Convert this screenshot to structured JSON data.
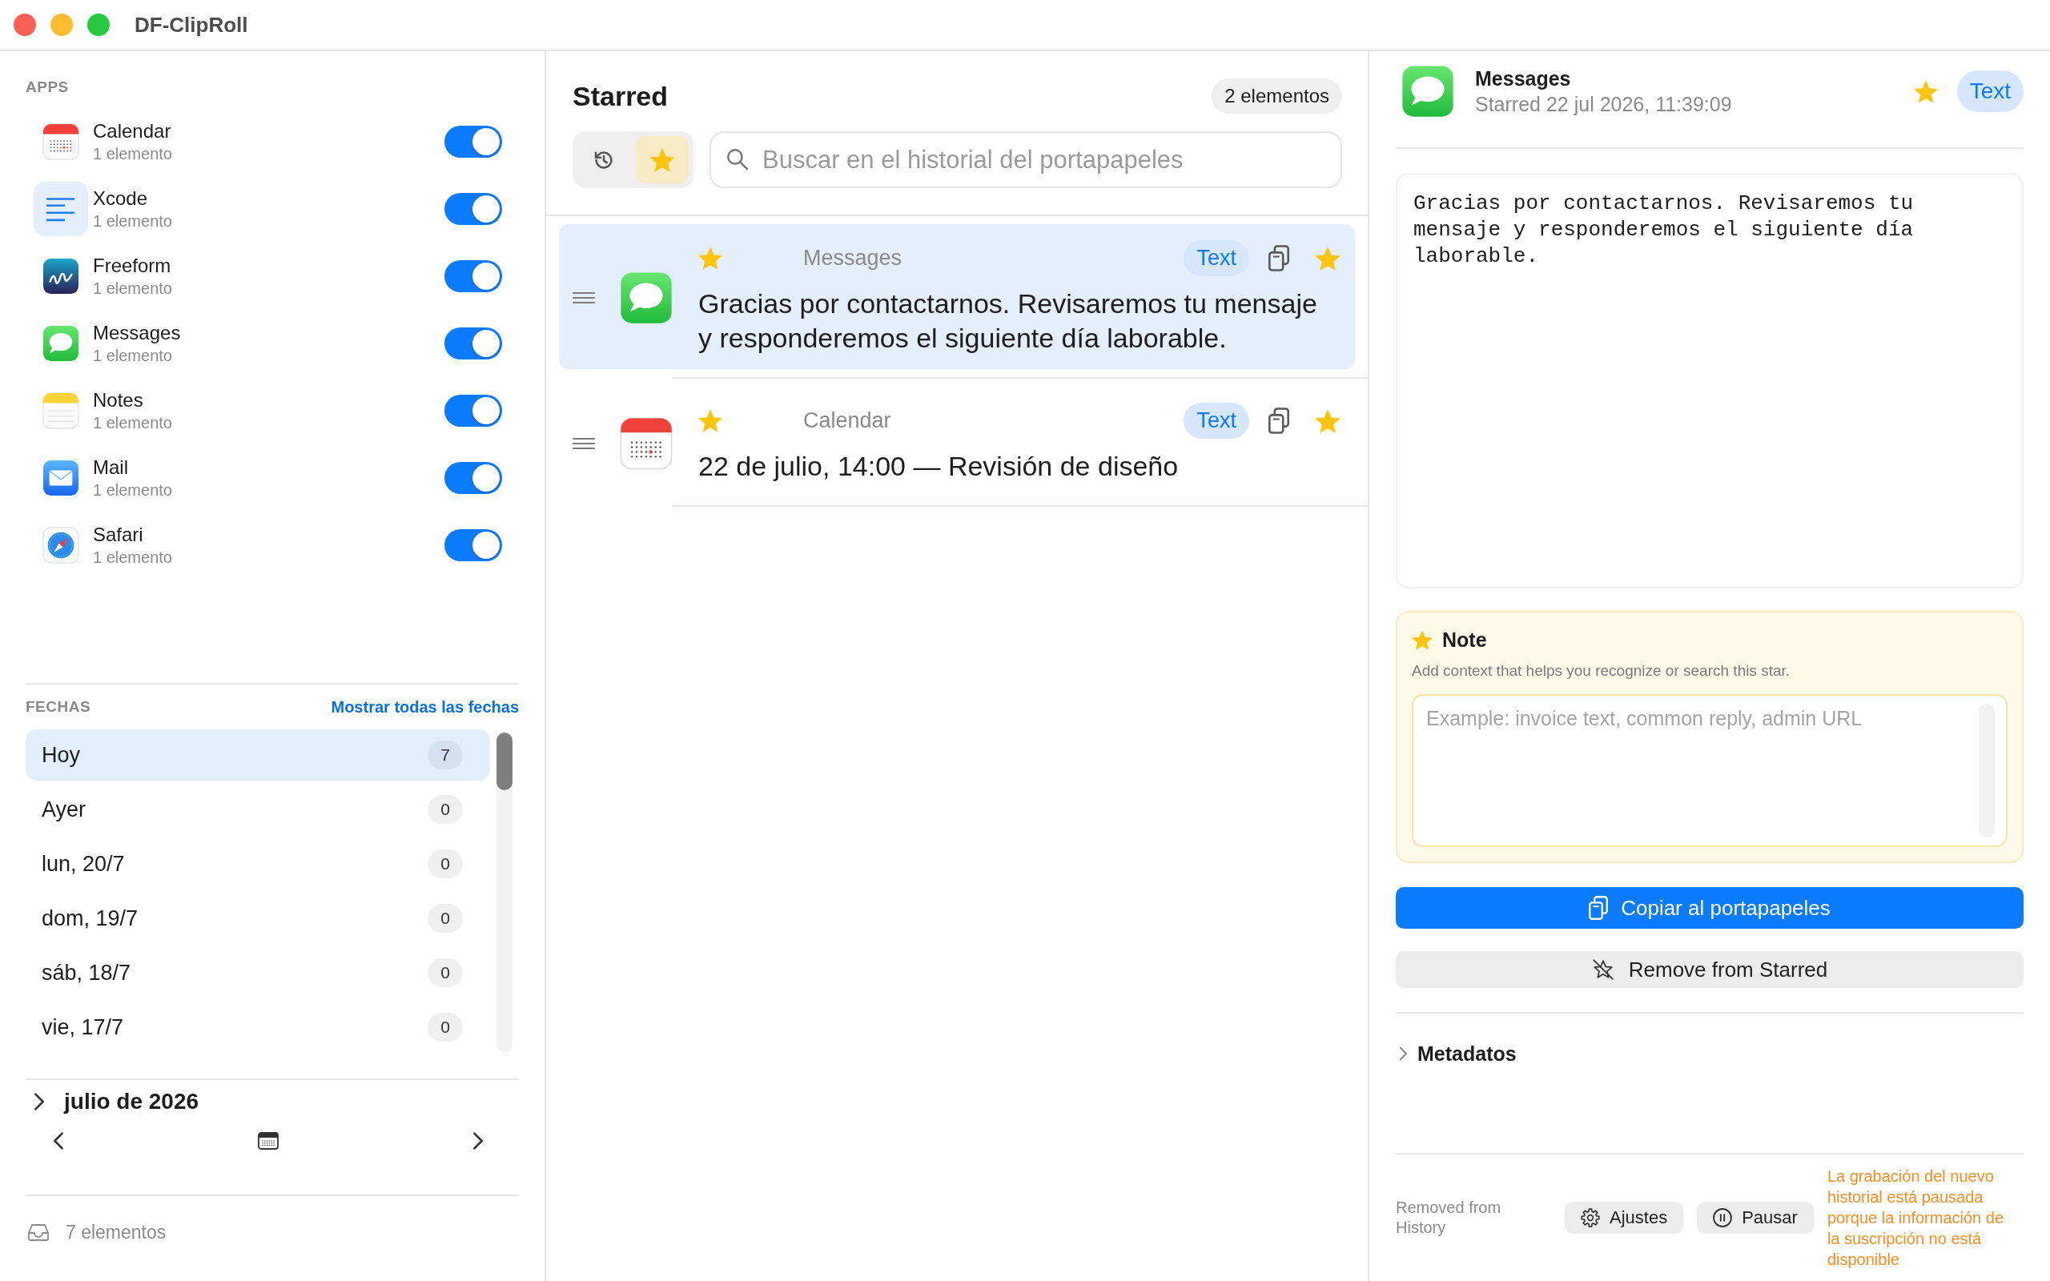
{
  "window": {
    "title": "DF-ClipRoll"
  },
  "sidebar": {
    "apps_heading": "APPS",
    "apps": [
      {
        "kind": "calendar",
        "name": "Calendar",
        "count": "1 elemento",
        "on": true
      },
      {
        "kind": "lines",
        "name": "Xcode",
        "count": "1 elemento",
        "on": true
      },
      {
        "kind": "freeform",
        "name": "Freeform",
        "count": "1 elemento",
        "on": true
      },
      {
        "kind": "messages",
        "name": "Messages",
        "count": "1 elemento",
        "on": true
      },
      {
        "kind": "notes",
        "name": "Notes",
        "count": "1 elemento",
        "on": true
      },
      {
        "kind": "mail",
        "name": "Mail",
        "count": "1 elemento",
        "on": true
      },
      {
        "kind": "safari",
        "name": "Safari",
        "count": "1 elemento",
        "on": true
      }
    ],
    "dates_heading": "FECHAS",
    "show_all_link": "Mostrar todas las fechas",
    "dates": [
      {
        "label": "Hoy",
        "count": "7",
        "selected": true
      },
      {
        "label": "Ayer",
        "count": "0",
        "selected": false
      },
      {
        "label": "lun, 20/7",
        "count": "0",
        "selected": false
      },
      {
        "label": "dom, 19/7",
        "count": "0",
        "selected": false
      },
      {
        "label": "sáb, 18/7",
        "count": "0",
        "selected": false
      },
      {
        "label": "vie, 17/7",
        "count": "0",
        "selected": false
      }
    ],
    "month": {
      "label": "julio de 2026",
      "expanded": false
    },
    "footer": "7 elementos"
  },
  "list": {
    "title": "Starred",
    "count": "2 elementos",
    "modes": [
      {
        "kind": "history",
        "selected": false
      },
      {
        "kind": "starred",
        "selected": true
      }
    ],
    "search": {
      "placeholder": "Buscar en el historial del portapapeles"
    },
    "clips": [
      {
        "kind": "messages",
        "app": "Messages",
        "type": "Text",
        "content": "Gracias por contactarnos. Revisaremos tu mensaje y responderemos el siguiente día laborable.",
        "starred": true,
        "selected": true
      },
      {
        "kind": "calendar",
        "app": "Calendar",
        "type": "Text",
        "content": "22 de julio, 14:00 — Revisión de diseño",
        "starred": true,
        "selected": false
      }
    ]
  },
  "detail": {
    "kind": "messages",
    "app": "Messages",
    "starred_at": "Starred 22 jul 2026, 11:39:09",
    "starred": true,
    "type": "Text",
    "content": "Gracias por contactarnos. Revisaremos tu mensaje y responderemos el siguiente día laborable.",
    "note": {
      "title": "Note",
      "description": "Add context that helps you recognize or search this star.",
      "placeholder": "Example: invoice text, common reply, admin URL"
    },
    "copy_button": "Copiar al portapapeles",
    "remove_button": "Remove from Starred",
    "metadata": {
      "label": "Metadatos",
      "expanded": false
    },
    "status": "Removed from History",
    "buttons": [
      {
        "kind": "settings",
        "label": "Ajustes"
      },
      {
        "kind": "pause",
        "label": "Pausar"
      }
    ],
    "warning": "La grabación del nuevo historial está pausada porque la información de la suscripción no está disponible"
  }
}
